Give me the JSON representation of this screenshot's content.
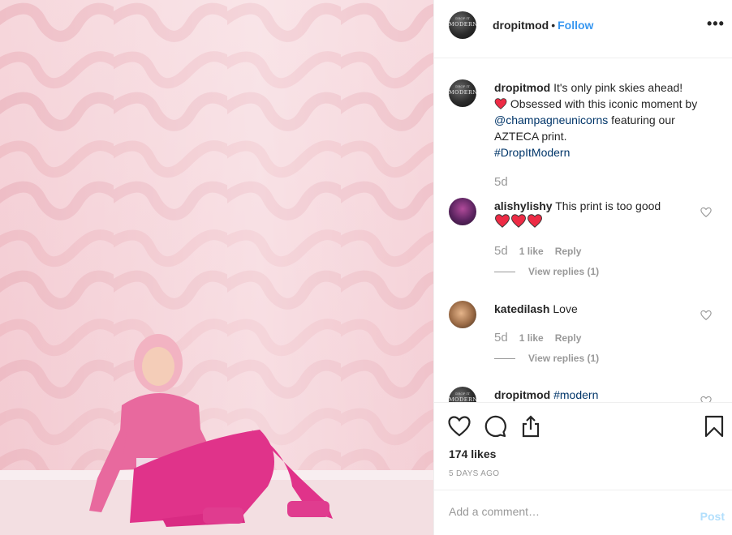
{
  "post": {
    "username": "dropitmod",
    "separator": "•",
    "follow_label": "Follow",
    "more_label": "•••",
    "avatar_text_top": "DROP IT",
    "avatar_text": "MODERN"
  },
  "caption": {
    "username": "dropitmod",
    "text1": " It's only pink skies ahead!",
    "text2": " Obsessed with this iconic moment by ",
    "mention": "@champagneunicorns",
    "text3": " featuring our AZTECA print.",
    "hashtag": "#DropItModern",
    "age": "5d"
  },
  "comments": [
    {
      "username": "alishylishy",
      "text": " This print is too good",
      "age": "5d",
      "likes": "1 like",
      "reply_label": "Reply",
      "view_replies": "View replies (1)"
    },
    {
      "username": "katedilash",
      "text": " Love",
      "age": "5d",
      "likes": "1 like",
      "reply_label": "Reply",
      "view_replies": "View replies (1)"
    },
    {
      "username": "dropitmod",
      "text": " ",
      "hashtag": "#modern"
    }
  ],
  "actions": {
    "likes": "174 likes",
    "date": "5 DAYS AGO"
  },
  "add_comment": {
    "placeholder": "Add a comment…",
    "post_label": "Post"
  },
  "colors": {
    "link_blue": "#3897f0",
    "tag_blue": "#003569",
    "muted": "#999999",
    "post_disabled": "#b2dffc",
    "heart_red": "#ed4956"
  },
  "icons": [
    "heart-icon",
    "comment-icon",
    "share-icon",
    "bookmark-icon",
    "more-icon"
  ]
}
